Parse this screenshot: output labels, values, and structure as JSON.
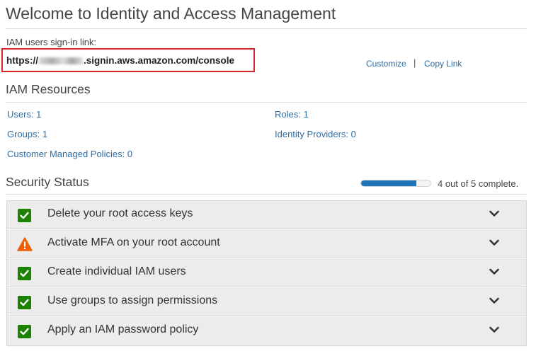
{
  "page": {
    "title": "Welcome to Identity and Access Management"
  },
  "signin": {
    "label": "IAM users sign-in link:",
    "url_prefix": "https://",
    "url_suffix": ".signin.aws.amazon.com/console",
    "customize": "Customize",
    "separator": "|",
    "copy_link": "Copy Link"
  },
  "resources": {
    "heading": "IAM Resources",
    "users": "Users: 1",
    "roles": "Roles: 1",
    "groups": "Groups: 1",
    "identity_providers": "Identity Providers: 0",
    "customer_managed_policies": "Customer Managed Policies: 0"
  },
  "security": {
    "heading": "Security Status",
    "progress_complete": 4,
    "progress_total": 5,
    "progress_text": "4 out of 5 complete.",
    "items": [
      {
        "label": "Delete your root access keys",
        "status": "complete",
        "icon": "check-icon"
      },
      {
        "label": "Activate MFA on your root account",
        "status": "warning",
        "icon": "warning-icon"
      },
      {
        "label": "Create individual IAM users",
        "status": "complete",
        "icon": "check-icon"
      },
      {
        "label": "Use groups to assign permissions",
        "status": "complete",
        "icon": "check-icon"
      },
      {
        "label": "Apply an IAM password policy",
        "status": "complete",
        "icon": "check-icon"
      }
    ]
  },
  "colors": {
    "link": "#2e6da4",
    "check_green": "#1d8102",
    "warning_orange": "#eb5f07",
    "progress_blue": "#1f73b7",
    "highlight_red": "#d9262d"
  }
}
